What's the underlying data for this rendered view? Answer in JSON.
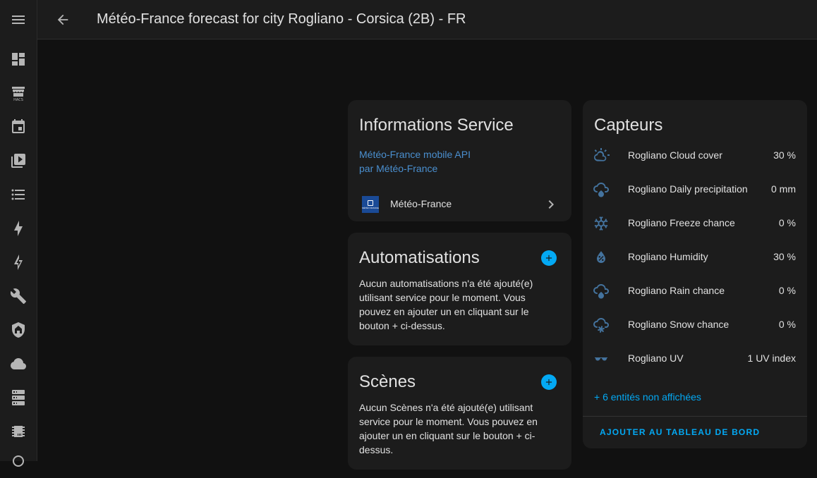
{
  "header": {
    "title": "Météo-France forecast for city Rogliano - Corsica (2B) - FR"
  },
  "sidebar": {
    "items": [
      {
        "name": "menu-icon"
      },
      {
        "name": "dashboard-icon"
      },
      {
        "name": "hacs-icon",
        "label": "HACS"
      },
      {
        "name": "calendar-icon"
      },
      {
        "name": "media-icon"
      },
      {
        "name": "list-icon"
      },
      {
        "name": "energy-icon"
      },
      {
        "name": "lightning-icon"
      },
      {
        "name": "wrench-icon"
      },
      {
        "name": "shield-home-icon"
      },
      {
        "name": "cloud-icon"
      },
      {
        "name": "server-icon"
      },
      {
        "name": "chip-icon"
      }
    ]
  },
  "info_card": {
    "title": "Informations Service",
    "link1": "Météo-France mobile API",
    "link2": "par Météo-France",
    "integration_name": "Météo-France",
    "logo_text": "MÉTÉO FRANCE"
  },
  "automations_card": {
    "title": "Automatisations",
    "text": "Aucun automatisations n'a été ajouté(e) utilisant service pour le moment. Vous pouvez en ajouter un en cliquant sur le bouton + ci-dessus."
  },
  "scenes_card": {
    "title": "Scènes",
    "text": "Aucun Scènes n'a été ajouté(e) utilisant service pour le moment. Vous pouvez en ajouter un en cliquant sur le bouton + ci-dessus."
  },
  "sensors_card": {
    "title": "Capteurs",
    "items": [
      {
        "icon": "weather-partly-cloudy-icon",
        "name": "Rogliano Cloud cover",
        "value": "30 %"
      },
      {
        "icon": "weather-rainy-icon",
        "name": "Rogliano Daily precipitation",
        "value": "0 mm"
      },
      {
        "icon": "snowflake-icon",
        "name": "Rogliano Freeze chance",
        "value": "0 %"
      },
      {
        "icon": "water-percent-icon",
        "name": "Rogliano Humidity",
        "value": "30 %"
      },
      {
        "icon": "weather-rainy-icon",
        "name": "Rogliano Rain chance",
        "value": "0 %"
      },
      {
        "icon": "weather-snowy-icon",
        "name": "Rogliano Snow chance",
        "value": "0 %"
      },
      {
        "icon": "sunglasses-icon",
        "name": "Rogliano UV",
        "value": "1 UV index"
      }
    ],
    "more_link": "+ 6 entités non affichées",
    "add_dashboard": "AJOUTER AU TABLEAU DE BORD"
  },
  "colors": {
    "accent": "#03a9f4",
    "icon": "#44739e",
    "link": "#4a8fcf",
    "card": "#1c1c1c",
    "background": "#111111"
  }
}
